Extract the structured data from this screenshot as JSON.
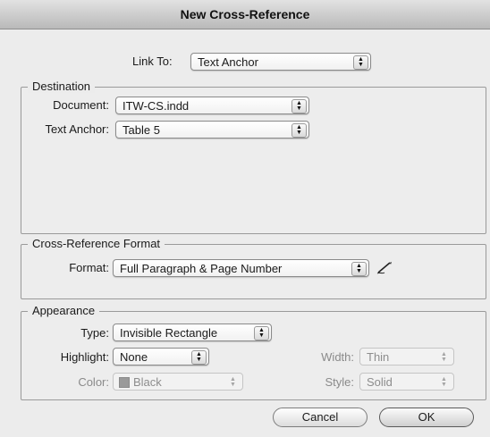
{
  "window": {
    "title": "New Cross-Reference"
  },
  "link_to": {
    "label": "Link To:",
    "value": "Text Anchor"
  },
  "destination": {
    "legend": "Destination",
    "document_label": "Document:",
    "document_value": "ITW-CS.indd",
    "anchor_label": "Text Anchor:",
    "anchor_value": "Table 5"
  },
  "format_group": {
    "legend": "Cross-Reference Format",
    "format_label": "Format:",
    "format_value": "Full Paragraph & Page Number"
  },
  "appearance": {
    "legend": "Appearance",
    "type_label": "Type:",
    "type_value": "Invisible Rectangle",
    "highlight_label": "Highlight:",
    "highlight_value": "None",
    "color_label": "Color:",
    "color_value": "Black",
    "width_label": "Width:",
    "width_value": "Thin",
    "style_label": "Style:",
    "style_value": "Solid"
  },
  "buttons": {
    "cancel": "Cancel",
    "ok": "OK"
  },
  "icons": {
    "popup_arrows": "updown-arrows-icon",
    "edit_format": "pencil-icon"
  }
}
